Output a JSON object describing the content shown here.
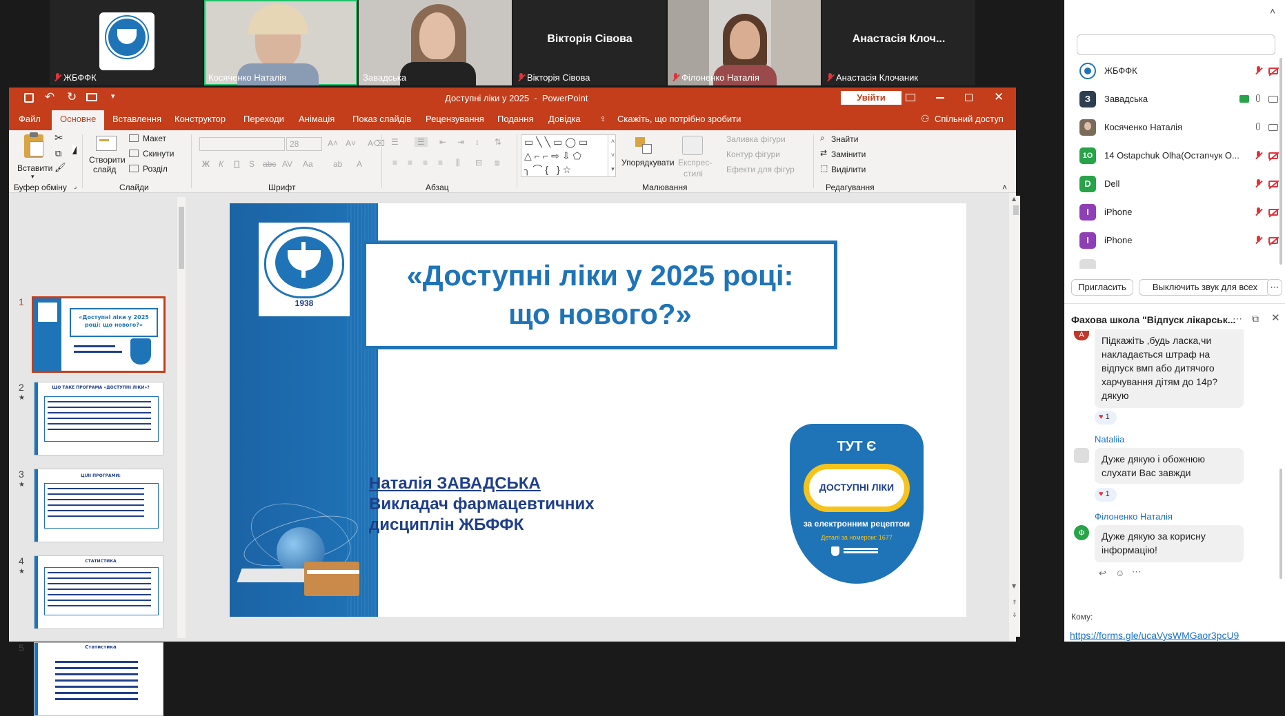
{
  "participants_strip": [
    {
      "name": "ЖБФФК"
    },
    {
      "name": "Косяченко Наталія"
    },
    {
      "name": "Завадська"
    },
    {
      "name": "Вікторія Сівова",
      "display": "Вікторія Сівова"
    },
    {
      "name": "Філоненко Наталія"
    },
    {
      "name": "Анастасія Клочаник",
      "display": "Анастасія Клоч..."
    }
  ],
  "ppt": {
    "window_title": "Доступні ліки у 2025  -  PowerPoint",
    "signin_label": "Увійти",
    "menu": [
      "Файл",
      "Основне",
      "Вставлення",
      "Конструктор",
      "Переходи",
      "Анімація",
      "Показ слайдів",
      "Рецензування",
      "Подання",
      "Довідка"
    ],
    "tell_me": "Скажіть, що потрібно зробити",
    "share": "Спільний доступ",
    "ribbon": {
      "paste": "Вставити",
      "new_slide_1": "Створити",
      "new_slide_2": "слайд",
      "layout": "Макет",
      "reset": "Скинути",
      "section": "Розділ",
      "arrange": "Упорядкувати",
      "quick_styles_1": "Експрес-",
      "quick_styles_2": "стилі",
      "shape_fill": "Заливка фігури",
      "shape_outline": "Контур фігури",
      "shape_effects": "Ефекти для фігур",
      "find": "Знайти",
      "replace": "Замінити",
      "select": "Виділити",
      "font_size": "28",
      "groups": {
        "clipboard": "Буфер обміну",
        "slides": "Слайди",
        "font": "Шрифт",
        "paragraph": "Абзац",
        "drawing": "Малювання",
        "editing": "Редагування"
      }
    },
    "thumbnails": [
      {
        "num": "1",
        "title": "«Доступні ліки у 2025 році: що нового?»"
      },
      {
        "num": "2",
        "title": "ЩО ТАКЕ ПРОГРАМА «ДОСТУПНІ ЛІКИ»?"
      },
      {
        "num": "3",
        "title": "ЦІЛІ ПРОГРАМИ:"
      },
      {
        "num": "4",
        "title": "СТАТИСТИКА"
      },
      {
        "num": "5",
        "title": "Статистика"
      }
    ],
    "slide": {
      "logo_year": "1938",
      "title_line1": "«Доступні ліки у 2025 році:",
      "title_line2": "що нового?»",
      "author_name": "Наталія ЗАВАДСЬКА",
      "author_role1": "Викладач фармацевтичних",
      "author_role2": "дисциплін ЖБФФК",
      "badge_top": "ТУТ Є",
      "badge_main": "ДОСТУПНІ ЛІКИ",
      "badge_sub": "за електронним рецептом",
      "badge_phone": "Деталі за номером: 1677"
    }
  },
  "panel": {
    "participants": [
      {
        "name": "ЖБФФК",
        "avatar": "",
        "color": "#1f74b8"
      },
      {
        "name": "Завадська",
        "avatar": "З",
        "color": "#2c3e50"
      },
      {
        "name": "Косяченко Наталія",
        "avatar": "",
        "color": "#7b6b5a"
      },
      {
        "name": "14 Ostapchuk Olha(Остапчук О...",
        "avatar": "1O",
        "color": "#27a348"
      },
      {
        "name": "Dell",
        "avatar": "D",
        "color": "#27a348"
      },
      {
        "name": "iPhone",
        "avatar": "I",
        "color": "#8e3fb5"
      },
      {
        "name": "iPhone",
        "avatar": "I",
        "color": "#8e3fb5"
      }
    ],
    "invite": "Пригласить",
    "mute_all": "Выключить звук для всех",
    "chat_title": "Фахова школа \"Відпуск лікарськ...",
    "messages": [
      {
        "avatar": "А",
        "text": "Підкажіть ,будь ласка,чи накладається штраф на відпуск вмп або дитячого харчування дітям до 14р? дякую",
        "react_count": "1"
      },
      {
        "sender": "Nataliia",
        "text": "Дуже дякую і обожнюю слухати Вас завжди",
        "react_count": "1"
      },
      {
        "sender": "Філоненко Наталія",
        "avatar": "Ф",
        "text": "Дуже дякую за корисну інформацію!"
      }
    ],
    "to_label": "Кому:",
    "link": "https://forms.gle/ucaVysWMGaor3pcU9"
  }
}
